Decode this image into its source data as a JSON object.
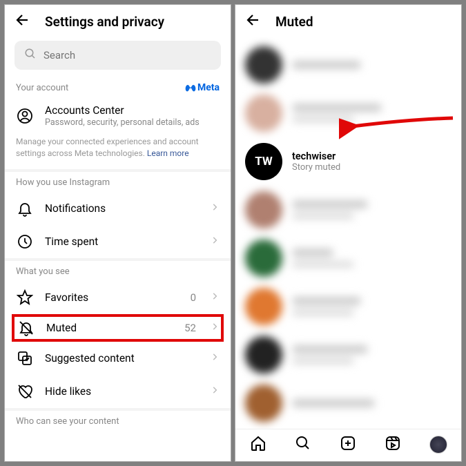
{
  "left": {
    "title": "Settings and privacy",
    "search_placeholder": "Search",
    "your_account_label": "Your account",
    "meta_label": "Meta",
    "accounts_center": {
      "title": "Accounts Center",
      "subtitle": "Password, security, personal details, ads"
    },
    "info_text": "Manage your connected experiences and account settings across Meta technologies. ",
    "learn_more": "Learn more",
    "section_how": "How you use Instagram",
    "notifications": "Notifications",
    "time_spent": "Time spent",
    "section_see": "What you see",
    "favorites": "Favorites",
    "favorites_value": "0",
    "muted": "Muted",
    "muted_value": "52",
    "suggested": "Suggested content",
    "hide_likes": "Hide likes",
    "section_who": "Who can see your content"
  },
  "right": {
    "title": "Muted",
    "users": [
      {
        "name": "techwiser",
        "sub": "Story muted",
        "avatar_text": "TW",
        "clear": true
      }
    ],
    "blurred_colors": [
      "#333",
      "#d8b0a0",
      "#2a6b3a",
      "#e07830",
      "#222",
      "#a06030"
    ]
  }
}
